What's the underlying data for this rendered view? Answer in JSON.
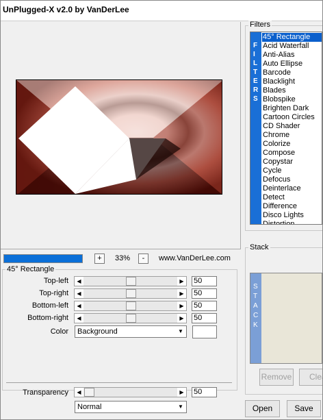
{
  "window": {
    "title": "UnPlugged-X v2.0 by VanDerLee"
  },
  "filters": {
    "label": "Filters",
    "vertical_label": [
      "F",
      "I",
      "L",
      "T",
      "E",
      "R",
      "S"
    ],
    "items": [
      "45° Rectangle",
      "Acid Waterfall",
      "Anti-Alias",
      "Auto Ellipse",
      "Barcode",
      "Blacklight",
      "Blades",
      "Blobspike",
      "Brighten Dark",
      "Cartoon Circles",
      "CD Shader",
      "Chrome",
      "Colorize",
      "Compose",
      "Copystar",
      "Cycle",
      "Defocus",
      "Deinterlace",
      "Detect",
      "Difference",
      "Disco Lights",
      "Distortion"
    ],
    "selected": "45° Rectangle"
  },
  "zoom": {
    "minus": "-",
    "plus": "+",
    "value": "33%"
  },
  "progress": {
    "fraction": 1.0
  },
  "website": "www.VanDerLee.com",
  "params": {
    "group_label": "45° Rectangle",
    "top_left": {
      "label": "Top-left",
      "value": "50"
    },
    "top_right": {
      "label": "Top-right",
      "value": "50"
    },
    "bottom_left": {
      "label": "Bottom-left",
      "value": "50"
    },
    "bottom_right": {
      "label": "Bottom-right",
      "value": "50"
    },
    "color": {
      "label": "Color",
      "value": "Background"
    },
    "transparency": {
      "label": "Transparency",
      "value": "50"
    },
    "blend": {
      "value": "Normal"
    }
  },
  "stack": {
    "label": "Stack",
    "vertical_label": [
      "S",
      "T",
      "A",
      "C",
      "K"
    ],
    "remove_label": "Remove",
    "clear_label": "Clea"
  },
  "buttons": {
    "open": "Open",
    "save": "Save"
  },
  "icons": {
    "left_arrow": "left-arrow-icon",
    "right_arrow": "right-arrow-icon",
    "dropdown": "chevron-down-icon"
  },
  "colors": {
    "selection": "#0b5fcc",
    "filters_bar": "#1a6fd6",
    "stack_bar": "#7b9fd6",
    "progress": "#0a6fd8"
  }
}
